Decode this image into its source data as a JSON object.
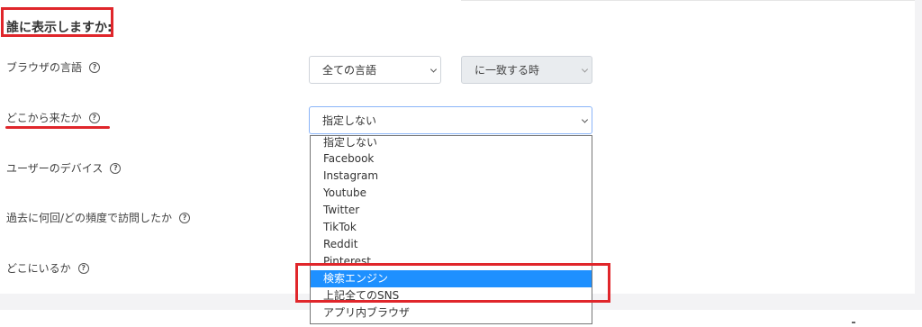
{
  "section": {
    "title": "誰に表示しますか:"
  },
  "rows": [
    {
      "label": "ブラウザの言語"
    },
    {
      "label": "どこから来たか"
    },
    {
      "label": "ユーザーのデバイス"
    },
    {
      "label": "過去に何回/どの頻度で訪問したか"
    },
    {
      "label": "どこにいるか"
    }
  ],
  "help_icon": {
    "glyph": "?"
  },
  "language_select": {
    "value": "全ての言語"
  },
  "match_select": {
    "value": "に一致する時"
  },
  "referrer_select": {
    "value": "指定しない",
    "options": [
      "指定しない",
      "Facebook",
      "Instagram",
      "Youtube",
      "Twitter",
      "TikTok",
      "Reddit",
      "Pinterest",
      "検索エンジン",
      "上記全てのSNS",
      "アプリ内ブラウザ"
    ],
    "highlighted_index": 8
  },
  "colors": {
    "annotation_red": "#e0262b",
    "selected_option": "#1e90ff"
  }
}
